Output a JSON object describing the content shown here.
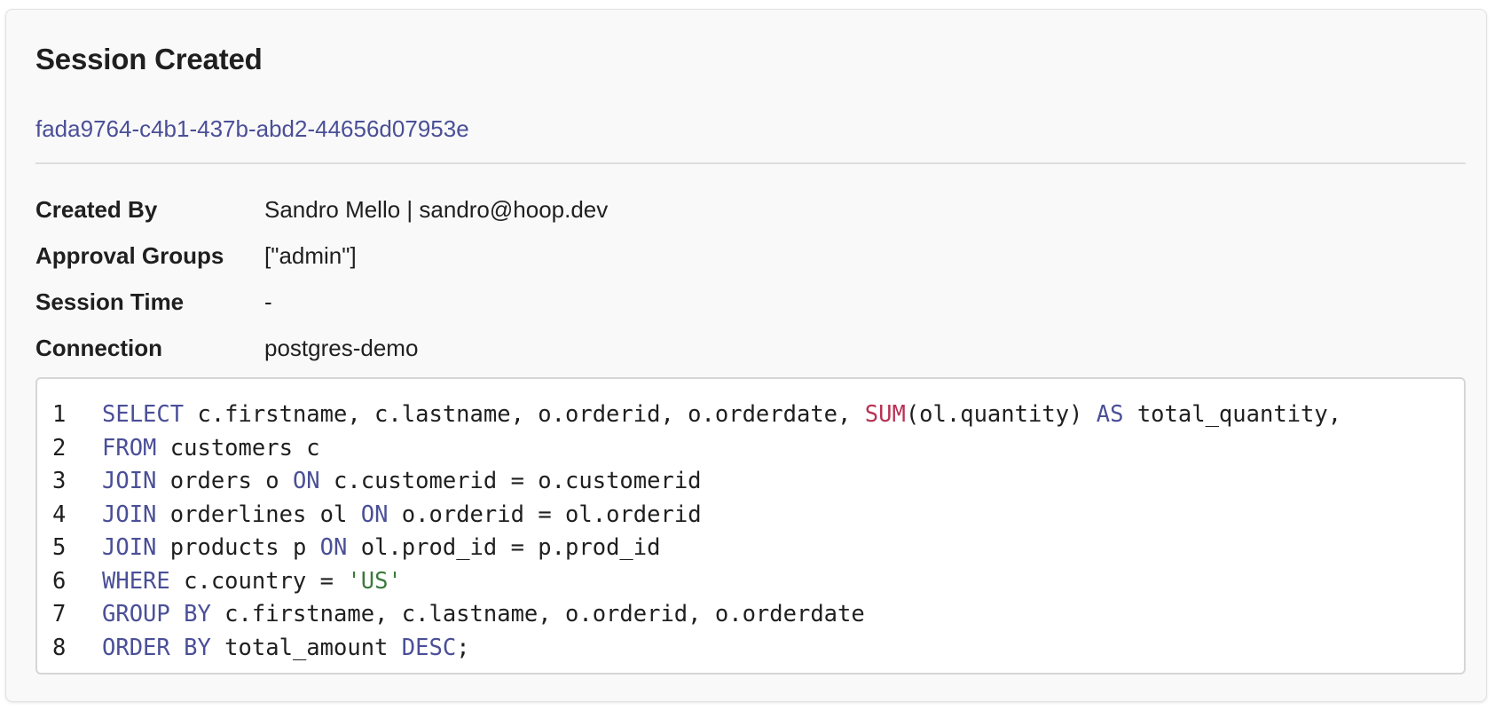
{
  "panel": {
    "title": "Session Created",
    "session_id": "fada9764-c4b1-437b-abd2-44656d07953e"
  },
  "details": [
    {
      "label": "Created By",
      "value": "Sandro Mello | sandro@hoop.dev"
    },
    {
      "label": "Approval Groups",
      "value": "[\"admin\"]"
    },
    {
      "label": "Session Time",
      "value": "-"
    },
    {
      "label": "Connection",
      "value": "postgres-demo"
    }
  ],
  "code": {
    "language": "sql",
    "colors": {
      "keyword": "#4a4f97",
      "function": "#b83254",
      "string": "#3a7a3c",
      "plain": "#1f1f1f"
    },
    "lines": [
      {
        "number": "1",
        "tokens": [
          {
            "t": "kw",
            "v": "SELECT"
          },
          {
            "t": "plain",
            "v": " c.firstname, c.lastname, o.orderid, o.orderdate, "
          },
          {
            "t": "fn",
            "v": "SUM"
          },
          {
            "t": "plain",
            "v": "(ol.quantity) "
          },
          {
            "t": "kw",
            "v": "AS"
          },
          {
            "t": "plain",
            "v": " total_quantity,"
          }
        ]
      },
      {
        "number": "2",
        "tokens": [
          {
            "t": "kw",
            "v": "FROM"
          },
          {
            "t": "plain",
            "v": " customers c"
          }
        ]
      },
      {
        "number": "3",
        "tokens": [
          {
            "t": "kw",
            "v": "JOIN"
          },
          {
            "t": "plain",
            "v": " orders o "
          },
          {
            "t": "kw",
            "v": "ON"
          },
          {
            "t": "plain",
            "v": " c.customerid = o.customerid"
          }
        ]
      },
      {
        "number": "4",
        "tokens": [
          {
            "t": "kw",
            "v": "JOIN"
          },
          {
            "t": "plain",
            "v": " orderlines ol "
          },
          {
            "t": "kw",
            "v": "ON"
          },
          {
            "t": "plain",
            "v": " o.orderid = ol.orderid"
          }
        ]
      },
      {
        "number": "5",
        "tokens": [
          {
            "t": "kw",
            "v": "JOIN"
          },
          {
            "t": "plain",
            "v": " products p "
          },
          {
            "t": "kw",
            "v": "ON"
          },
          {
            "t": "plain",
            "v": " ol.prod_id = p.prod_id"
          }
        ]
      },
      {
        "number": "6",
        "tokens": [
          {
            "t": "kw",
            "v": "WHERE"
          },
          {
            "t": "plain",
            "v": " c.country = "
          },
          {
            "t": "str",
            "v": "'US'"
          }
        ]
      },
      {
        "number": "7",
        "tokens": [
          {
            "t": "kw",
            "v": "GROUP BY"
          },
          {
            "t": "plain",
            "v": " c.firstname, c.lastname, o.orderid, o.orderdate"
          }
        ]
      },
      {
        "number": "8",
        "tokens": [
          {
            "t": "kw",
            "v": "ORDER BY"
          },
          {
            "t": "plain",
            "v": " total_amount "
          },
          {
            "t": "kw",
            "v": "DESC"
          },
          {
            "t": "plain",
            "v": ";"
          }
        ]
      }
    ]
  }
}
